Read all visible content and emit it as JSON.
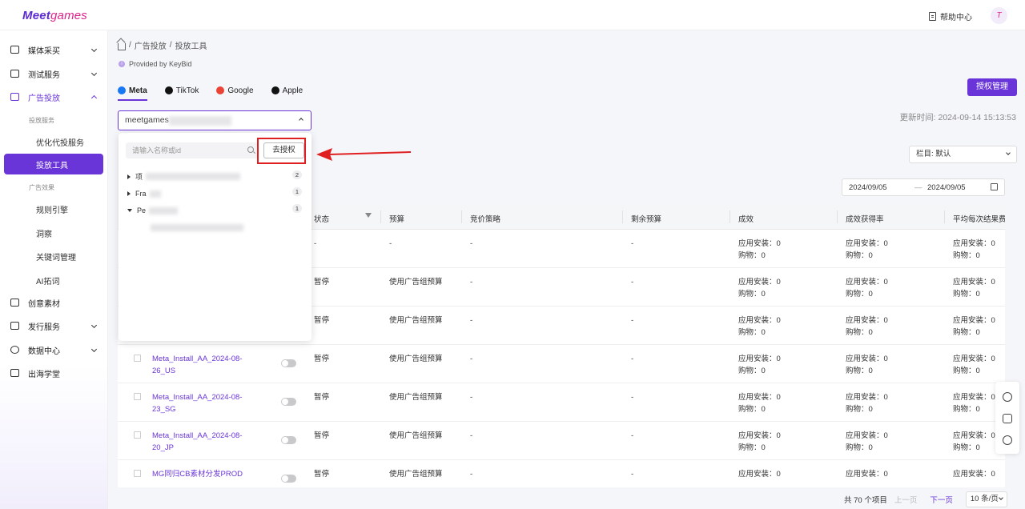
{
  "app": {
    "logo_main": "Meet",
    "logo_accent": "games"
  },
  "header": {
    "help_label": "帮助中心",
    "avatar_initial": "T"
  },
  "sidebar": {
    "items": [
      {
        "label": "媒体采买"
      },
      {
        "label": "测试服务"
      },
      {
        "label": "广告投放"
      },
      {
        "label": "创意素材"
      },
      {
        "label": "发行服务"
      },
      {
        "label": "数据中心"
      },
      {
        "label": "出海学堂"
      }
    ],
    "group1": "投放服务",
    "sub1": "优化代投服务",
    "sub_active": "投放工具",
    "group2": "广告效果",
    "sub2": [
      "规则引擎",
      "洞察",
      "关键词管理",
      "AI拓词"
    ]
  },
  "breadcrumb": {
    "sep1": "/",
    "level1": "广告投放",
    "sep2": "/",
    "level2": "投放工具"
  },
  "provided_by": "Provided by KeyBid",
  "tabs": [
    {
      "label": "Meta",
      "color": "#1877f2"
    },
    {
      "label": "TikTok",
      "color": "#111111"
    },
    {
      "label": "Google",
      "color": "#ea4335"
    },
    {
      "label": "Apple",
      "color": "#111111"
    }
  ],
  "auth_manage_label": "授权管理",
  "update_time": "更新时间:  2024-09-14 15:13:53",
  "account_select": {
    "value": "meetgames"
  },
  "column_select": {
    "value": "栏目: 默认"
  },
  "date_range": {
    "start": "2024/09/05",
    "sep": "—",
    "end": "2024/09/05"
  },
  "popover": {
    "search_placeholder": "请输入名称或id",
    "goto_auth_label": "去授权",
    "tree": [
      {
        "prefix": "项",
        "count": "2"
      },
      {
        "prefix": "Fra",
        "count": "1"
      },
      {
        "prefix": "Pe",
        "count": "1"
      }
    ]
  },
  "table": {
    "headers": [
      "状态",
      "预算",
      "竞价策略",
      "剩余预算",
      "成效",
      "成效获得率",
      "平均每次结果费"
    ],
    "install_label": "应用安装：",
    "purchase_label": "购物：",
    "rows": [
      {
        "name": "",
        "status": "-",
        "budget": "-",
        "bid": "-",
        "remain": "-",
        "install": "0",
        "purchase": "0"
      },
      {
        "name": "",
        "status": "暂停",
        "budget": "使用广告组预算",
        "bid": "-",
        "remain": "-",
        "install": "0",
        "purchase": "0"
      },
      {
        "name": "",
        "status": "暂停",
        "budget": "使用广告组预算",
        "bid": "-",
        "remain": "-",
        "install": "0",
        "purchase": "0"
      },
      {
        "name_l1": "Meta_Install_AA_2024-08-",
        "name_l2": "26_US",
        "status": "暂停",
        "budget": "使用广告组预算",
        "bid": "-",
        "remain": "-",
        "install": "0",
        "purchase": "0"
      },
      {
        "name_l1": "Meta_Install_AA_2024-08-",
        "name_l2": "23_SG",
        "status": "暂停",
        "budget": "使用广告组预算",
        "bid": "-",
        "remain": "-",
        "install": "0",
        "purchase": "0"
      },
      {
        "name_l1": "Meta_Install_AA_2024-08-",
        "name_l2": "20_JP",
        "status": "暂停",
        "budget": "使用广告组预算",
        "bid": "-",
        "remain": "-",
        "install": "0",
        "purchase": "0"
      },
      {
        "name_l1": "MG同归CB素材分发PROD",
        "name_l2": "",
        "status": "暂停",
        "budget": "使用广告组预算",
        "bid": "-",
        "remain": "-",
        "install": "0",
        "purchase": ""
      }
    ]
  },
  "pager": {
    "total": "共 70 个项目",
    "prev": "上一页",
    "next": "下一页",
    "size": "10 条/页"
  }
}
